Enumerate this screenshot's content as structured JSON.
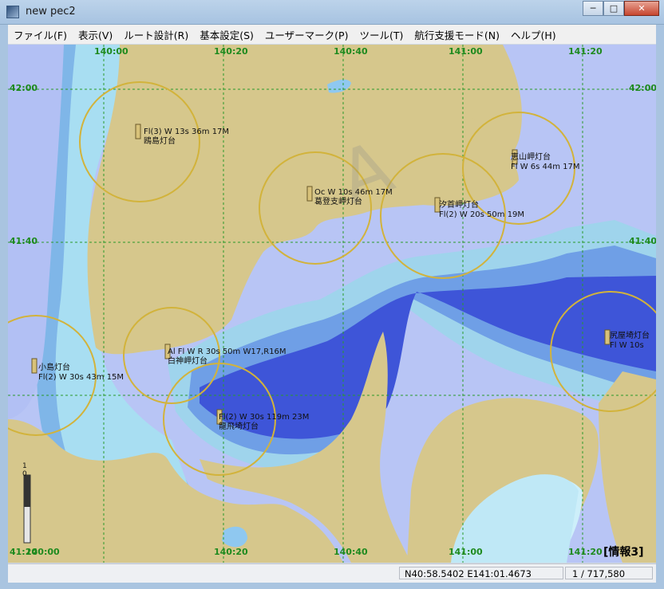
{
  "window": {
    "title": "new pec2",
    "minimize": "─",
    "maximize": "□",
    "close": "✕"
  },
  "menu": [
    {
      "id": "file",
      "label": "ファイル(F)"
    },
    {
      "id": "view",
      "label": "表示(V)"
    },
    {
      "id": "route",
      "label": "ルート設計(R)"
    },
    {
      "id": "settings",
      "label": "基本設定(S)"
    },
    {
      "id": "usermark",
      "label": "ユーザーマーク(P)"
    },
    {
      "id": "tools",
      "label": "ツール(T)"
    },
    {
      "id": "navigation",
      "label": "航行支援モード(N)"
    },
    {
      "id": "help",
      "label": "ヘルプ(H)"
    }
  ],
  "map": {
    "grid_labels_top": [
      "140:00",
      "140:20",
      "140:40",
      "141:00",
      "141:20"
    ],
    "grid_labels_bottom": [
      "140:00",
      "140:20",
      "140:40",
      "141:00",
      "141:20"
    ],
    "grid_labels_left": [
      "42:00",
      "41:40",
      "41:20"
    ],
    "grid_labels_right": [
      "42:00",
      "41:40"
    ],
    "lighthouses": [
      {
        "name": "鴎島灯台",
        "light": "Fl(3) W 13s 36m 17M"
      },
      {
        "name": "恵山岬灯台",
        "light": "Fl W 6s 44m 17M"
      },
      {
        "name": "葛登支岬灯台",
        "light": "Oc W 10s 46m 17M"
      },
      {
        "name": "汐首岬灯台",
        "light": "Fl(2) W 20s 50m 19M"
      },
      {
        "name": "小島灯台",
        "light": "Fl(2) W 30s 43m 15M"
      },
      {
        "name": "白神岬灯台",
        "light": "Al Fl W R 30s 50m W17,R16M"
      },
      {
        "name": "龍飛埼灯台",
        "light": "Fl(2) W 30s 119m 23M"
      },
      {
        "name": "尻屋埼灯台",
        "light": "Fl W 10s"
      }
    ],
    "info_badge": "[情報3]",
    "depth_scale_label": "1\n0"
  },
  "status": {
    "coord": "N40:58.5402 E141:01.4673",
    "scale": "1 / 717,580"
  },
  "colors": {
    "land": "#d6c78c",
    "deep": "#1f2fd0",
    "shallow": "#cbeef6",
    "grid": "#2a9a2a",
    "light_arc": "#d2b33b"
  }
}
